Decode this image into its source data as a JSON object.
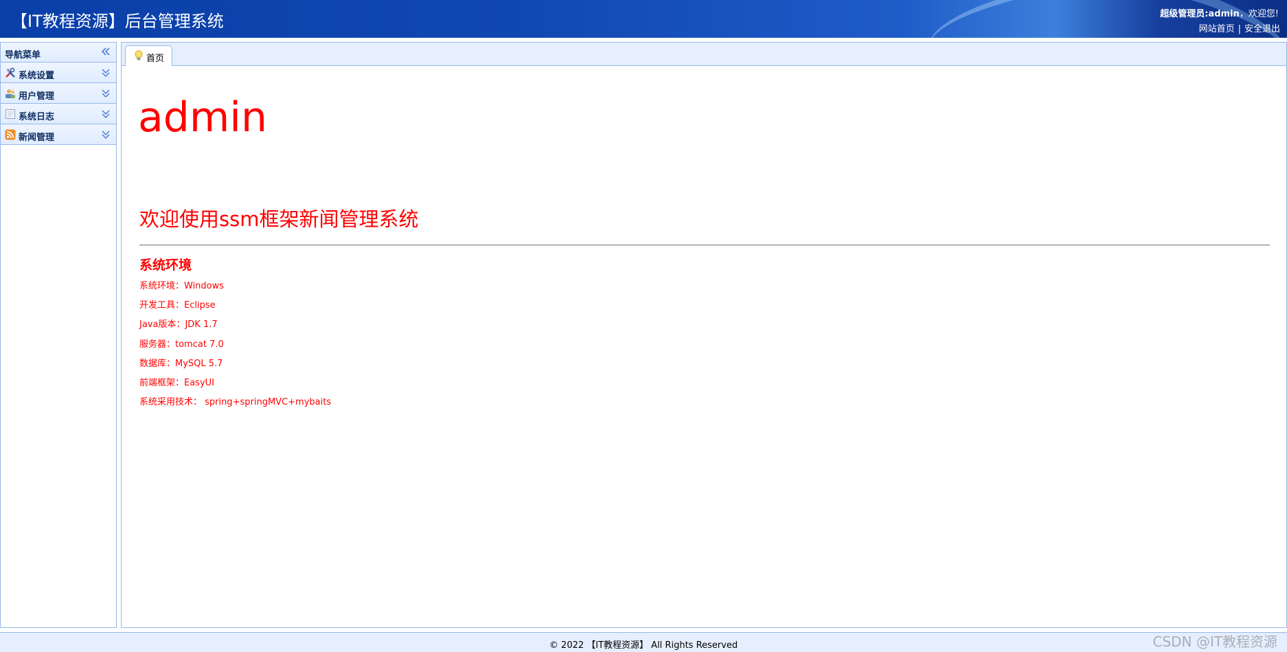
{
  "header": {
    "title": "【IT教程资源】后台管理系统",
    "user_role": "超级管理员:admin",
    "greeting": "，欢迎您!",
    "home_link": "网站首页",
    "separator": "|",
    "logout_link": "安全退出"
  },
  "sidebar": {
    "title": "导航菜单",
    "items": [
      {
        "label": "系统设置",
        "icon": "tools-icon"
      },
      {
        "label": "用户管理",
        "icon": "users-icon"
      },
      {
        "label": "系统日志",
        "icon": "log-icon"
      },
      {
        "label": "新闻管理",
        "icon": "rss-icon"
      }
    ]
  },
  "tabs": [
    {
      "label": "首页",
      "icon": "lightbulb-icon"
    }
  ],
  "content": {
    "username": "admin",
    "welcome": "欢迎使用ssm框架新闻管理系统",
    "env_title": "系统环境",
    "env_items": [
      "系统环境：Windows",
      "开发工具：Eclipse",
      "Java版本：JDK 1.7",
      "服务器：tomcat 7.0",
      "数据库：MySQL 5.7",
      "前端框架：EasyUI",
      "系统采用技术：  spring+springMVC+mybaits"
    ]
  },
  "footer": {
    "copyright": "© 2022 【IT教程资源】 All Rights Reserved"
  },
  "watermark": "CSDN @IT教程资源",
  "colors": {
    "accent_red": "#ff0000",
    "panel_border": "#95b8e7",
    "panel_header": "#e0ecff",
    "header_blue": "#1147b3"
  }
}
